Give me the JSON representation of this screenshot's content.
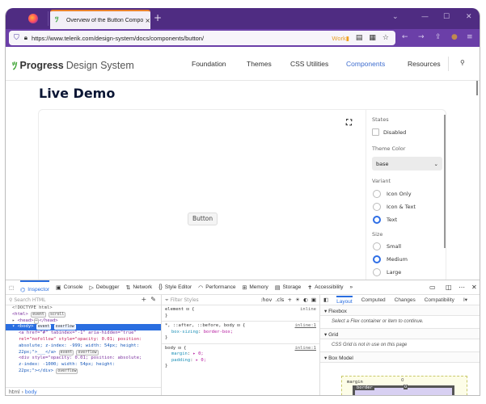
{
  "browser": {
    "tab_title": "Overview of the Button Compor",
    "url": "https://www.telerik.com/design-system/docs/components/button/",
    "container_label": "Work",
    "icons": {
      "favicon": "progress-logo-icon",
      "newtab": "+",
      "close": "×",
      "chevron": "⌄",
      "minimize": "—",
      "maximize": "☐",
      "win_close": "✕",
      "shield": "⛉",
      "lock": "🔒",
      "reader": "▤",
      "qr": "▦",
      "star": "☆",
      "back": "←",
      "forward": "→",
      "share": "⇪",
      "profile": "●",
      "menu": "≡"
    }
  },
  "site": {
    "logo_brand": "Progress",
    "logo_suffix": "Design System",
    "nav": [
      {
        "label": "Foundation",
        "active": false
      },
      {
        "label": "Themes",
        "active": false
      },
      {
        "label": "CSS Utilities",
        "active": false
      },
      {
        "label": "Components",
        "active": true
      },
      {
        "label": "Resources",
        "active": false
      }
    ],
    "search_icon": "⚲",
    "page_title": "Live Demo"
  },
  "demo": {
    "button_label": "Button",
    "fullscreen_icon": "⛶",
    "options": {
      "states_label": "States",
      "disabled_label": "Disabled",
      "disabled_checked": false,
      "theme_color_label": "Theme Color",
      "theme_color_value": "base",
      "variant_label": "Variant",
      "variants": [
        {
          "label": "Icon Only",
          "selected": false
        },
        {
          "label": "Icon & Text",
          "selected": false
        },
        {
          "label": "Text",
          "selected": true
        }
      ],
      "size_label": "Size",
      "sizes": [
        {
          "label": "Small",
          "selected": false
        },
        {
          "label": "Medium",
          "selected": true
        },
        {
          "label": "Large",
          "selected": false
        }
      ]
    }
  },
  "devtools": {
    "tabs": [
      {
        "label": "Inspector",
        "icon": "⌬",
        "active": true
      },
      {
        "label": "Console",
        "icon": "▣",
        "active": false
      },
      {
        "label": "Debugger",
        "icon": "▷",
        "active": false
      },
      {
        "label": "Network",
        "icon": "⇅",
        "active": false
      },
      {
        "label": "Style Editor",
        "icon": "{}",
        "active": false
      },
      {
        "label": "Performance",
        "icon": "◠",
        "active": false
      },
      {
        "label": "Memory",
        "icon": "⊞",
        "active": false
      },
      {
        "label": "Storage",
        "icon": "▤",
        "active": false
      },
      {
        "label": "Accessibility",
        "icon": "✝",
        "active": false
      }
    ],
    "more_tabs": "»",
    "html_search_placeholder": "Search HTML",
    "tree": {
      "doctype": "<!DOCTYPE html>",
      "html_open": "<html>",
      "html_badges": [
        "event",
        "scroll"
      ],
      "head": "<head>",
      "head_ellipsis": "⋯",
      "head_close": "</head>",
      "body_open": "<body>",
      "body_badges": [
        "event",
        "overflow"
      ],
      "a_line1": "<a href=\"#\" tabindex=\"-1\" aria-hidden=\"true\"",
      "a_line2": "rel=\"nofollow\" style=\"opacity: 0.01; position:",
      "a_line3": "absolute; z-index: -999; width: 54px; height:",
      "a_line4": "22px;\">___</a>",
      "a_badges": [
        "event",
        "overflow"
      ],
      "div_line1": "<div style=\"opacity: 0.01; position: absolute;",
      "div_line2": "z-index: -1000; width: 54px; height:",
      "div_line3": "22px;\"></div>",
      "div_badges": [
        "overflow"
      ]
    },
    "breadcrumb": [
      "html",
      "body"
    ],
    "rules_filter_placeholder": "Filter Styles",
    "rules_toolbar": [
      ":hov",
      ".cls"
    ],
    "rules": [
      {
        "selector": "element ⊡ {",
        "source": "inline",
        "props": []
      },
      {
        "selector": "*, ::after, ::before, body ⊡ {",
        "source": "inline:1",
        "props": [
          {
            "name": "box-sizing",
            "value": "border-box;"
          }
        ]
      },
      {
        "selector": "body ⊡ {",
        "source": "inline:1",
        "props": [
          {
            "name": "margin",
            "value": "▸ 0;"
          },
          {
            "name": "padding",
            "value": "▸ 0;"
          }
        ]
      }
    ],
    "layout_tabs": [
      {
        "label": "Layout",
        "active": true
      },
      {
        "label": "Computed",
        "active": false
      },
      {
        "label": "Changes",
        "active": false
      },
      {
        "label": "Compatibility",
        "active": false
      }
    ],
    "sections": {
      "flexbox": "Flexbox",
      "flexbox_msg": "Select a Flex container or item to continue.",
      "grid": "Grid",
      "grid_msg": "CSS Grid is not in use on this page",
      "boxmodel": "Box Model"
    },
    "boxmodel": {
      "margin_label": "margin",
      "margin_value": "0",
      "border_label": "border",
      "border_value": "0"
    }
  }
}
